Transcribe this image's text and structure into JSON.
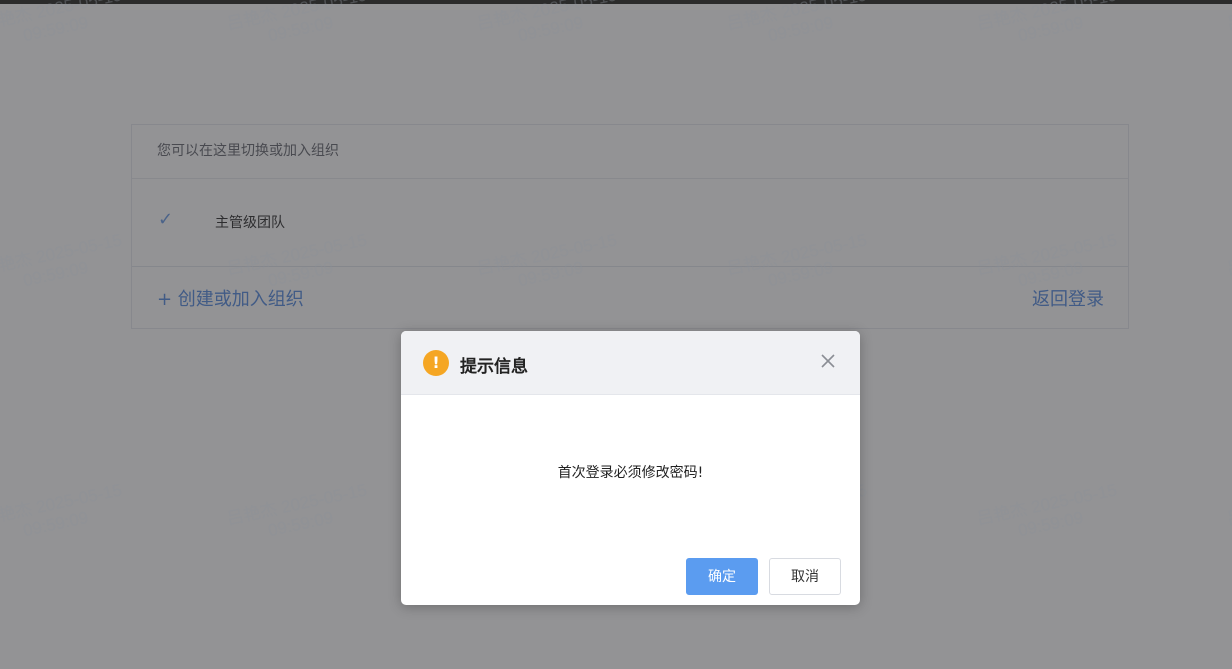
{
  "org_card": {
    "header_text": "您可以在这里切换或加入组织",
    "items": [
      {
        "label": "主管级团队",
        "selected": true
      }
    ],
    "create_link": "+ 创建或加入组织",
    "back_link": "返回登录"
  },
  "dialog": {
    "title": "提示信息",
    "icon": "warning-icon",
    "message": "首次登录必须修改密码!",
    "confirm_label": "确定",
    "cancel_label": "取消"
  },
  "watermark": {
    "name": "吕艳杰",
    "date": "2025-05-15",
    "time": "09:59:09"
  },
  "colors": {
    "accent": "#5b9cf0",
    "link": "#5a8ee0",
    "warning": "#f5a623",
    "overlay": "rgba(40,40,44,0.5)"
  }
}
